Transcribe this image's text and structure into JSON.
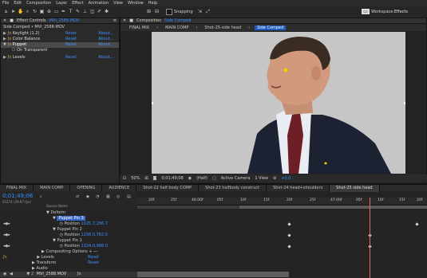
{
  "menu": [
    "File",
    "Edit",
    "Composition",
    "Layer",
    "Effect",
    "Animation",
    "View",
    "Window",
    "Help"
  ],
  "toolbar": {
    "snapping_label": "Snapping",
    "workspace_label": "Workspace:",
    "workspace_value": "Effects"
  },
  "effect_controls": {
    "tab_title": "Effect Controls",
    "tab_file": "MVI_2588.MOV",
    "breadcrumb": "Side Comped • MVI_2588.MOV",
    "effects": [
      {
        "name": "Keylight (1.2)",
        "reset": "Reset",
        "about": "About..."
      },
      {
        "name": "Color Balance",
        "reset": "Reset",
        "about": "About..."
      },
      {
        "name": "Puppet",
        "reset": "Reset",
        "about": "About...",
        "selected": true
      },
      {
        "name": "On Transparent",
        "reset": "",
        "about": ""
      },
      {
        "name": "Levels",
        "reset": "Reset",
        "about": "About..."
      }
    ]
  },
  "composition": {
    "tab_title": "Composition",
    "tab_name": "Side Comped",
    "tabs": [
      "FINAL MIX",
      "MAIN COMP",
      "Shot-25-side head",
      "Side Comped"
    ],
    "active_tab": 3
  },
  "viewer_bar": {
    "zoom": "50%",
    "timecode": "0;01;49;08",
    "resolution": "(Half)",
    "camera": "Active Camera",
    "views": "1 View",
    "exposure": "+0.0"
  },
  "timeline_tabs": [
    "FINAL MIX",
    "MAIN COMP",
    "OPENING",
    "AUDIENCE",
    "Shot-22 half body COMP",
    "Shot-23 halfbody construct",
    "Shot-24 head+shoulders",
    "Shot-25 side head"
  ],
  "timeline": {
    "timecode": "0;01;49;08",
    "frame_info": "03274 (29.97 fps)",
    "header_label": "Source Name",
    "ruler_ticks": [
      "20f",
      "25f",
      "46:00f",
      "05f",
      "10f",
      "15f",
      "20f",
      "25f",
      "47:00f",
      "05f",
      "10f",
      "15f",
      "20f"
    ],
    "layers": [
      {
        "label": "Deform",
        "indent": 1
      },
      {
        "label": "Puppet Pin 3",
        "indent": 2,
        "selected": true
      },
      {
        "label": "Position",
        "value": "1025.7,286.7",
        "indent": 3
      },
      {
        "label": "Puppet Pin 2",
        "indent": 2
      },
      {
        "label": "Position",
        "value": "1208.0,762.0",
        "indent": 3
      },
      {
        "label": "Puppet Pin 1",
        "indent": 2
      },
      {
        "label": "Position",
        "value": "1324.0,988.0",
        "indent": 3
      },
      {
        "label": "Compositing Options",
        "indent": 1,
        "extra": "+ —"
      },
      {
        "label": "Levels",
        "indent": 0,
        "reset": "Reset"
      },
      {
        "label": "Transform",
        "indent": 0,
        "reset": "Reset"
      },
      {
        "label": "Audio",
        "indent": 0
      },
      {
        "label": "MVI_2588.MOV",
        "indent": 0,
        "number": "2"
      }
    ]
  }
}
